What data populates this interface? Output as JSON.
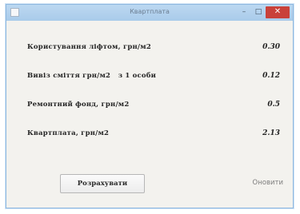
{
  "window": {
    "title": "Квартплата",
    "controls": {
      "minimize": "–",
      "maximize": "□",
      "close": "✕"
    },
    "icon": "app-window-icon"
  },
  "rows": [
    {
      "label": "Користування ліфтом, грн/м2",
      "value": "0.30"
    },
    {
      "label": "Вивіз сміття грн/м2   з 1 особи",
      "value": "0.12"
    },
    {
      "label": "Ремонтний фонд, грн/м2",
      "value": "0.5"
    },
    {
      "label": "Квартплата, грн/м2",
      "value": "2.13"
    }
  ],
  "actions": {
    "calculate_label": "Розрахувати",
    "clear_label": "Оновити"
  },
  "colors": {
    "titlebar": "#bcd8f1",
    "close_button": "#c9413a",
    "window_background": "#f3f2ee"
  }
}
